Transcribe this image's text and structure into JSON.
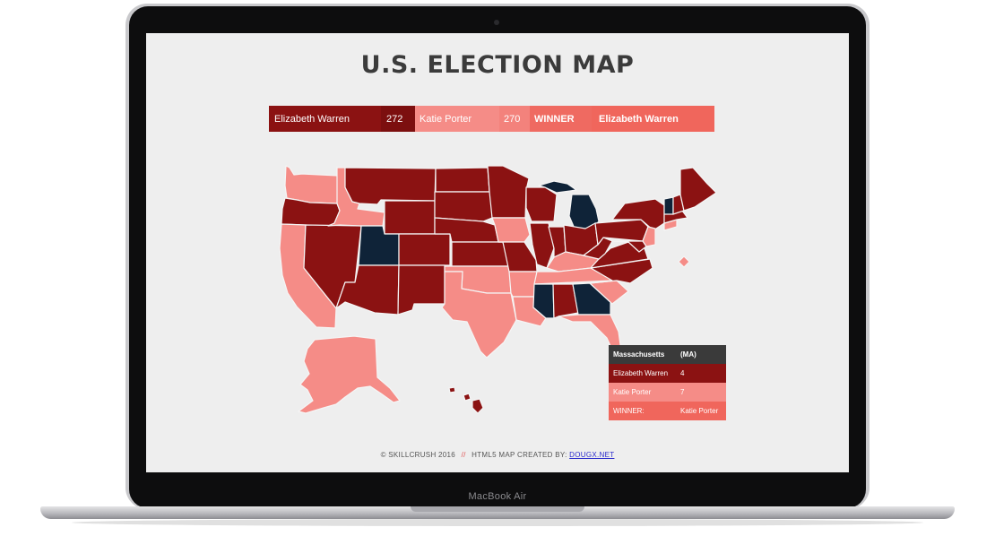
{
  "device": {
    "model_label": "MacBook Air"
  },
  "page": {
    "title": "U.S. ELECTION MAP"
  },
  "scoreboard": {
    "candidate1": {
      "name": "Elizabeth Warren",
      "votes": "272",
      "color": "#8b1212"
    },
    "candidate2": {
      "name": "Katie Porter",
      "votes": "270",
      "color": "#f58c87"
    },
    "winner_label": "WINNER",
    "winner_name": "Elizabeth Warren"
  },
  "map_colors": {
    "candidate1": "#8b1212",
    "candidate2": "#f58c87",
    "tie": "#0f2338",
    "border": "#f5f5f5"
  },
  "tooltip": {
    "state_name": "Massachusetts",
    "state_abbr": "(MA)",
    "rows": [
      {
        "label": "Elizabeth Warren",
        "value": "4"
      },
      {
        "label": "Katie Porter",
        "value": "7"
      },
      {
        "label": "WINNER:",
        "value": "Katie Porter"
      }
    ]
  },
  "footer": {
    "copyright": "© SKILLCRUSH 2016",
    "separator": "//",
    "credit_prefix": "HTML5 MAP CREATED BY:",
    "credit_link": "DOUGX.NET"
  }
}
